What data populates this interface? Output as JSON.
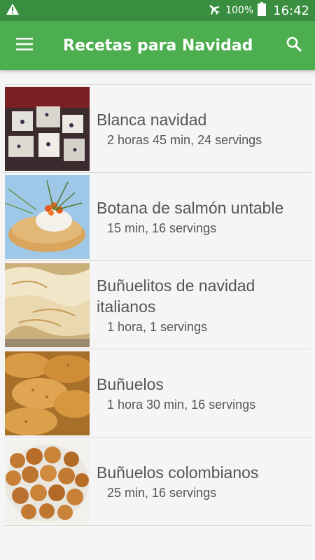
{
  "status_bar": {
    "battery_percent": "100%",
    "time": "16:42",
    "icons": [
      "warning-icon",
      "airplane-mode-icon",
      "battery-icon"
    ]
  },
  "app_bar": {
    "title": "Recetas para Navidad",
    "icons": [
      "menu-icon",
      "search-icon"
    ]
  },
  "recipes": [
    {
      "title": "Blanca navidad",
      "meta": "2 horas 45 min, 24 servings"
    },
    {
      "title": "Botana de salmón untable",
      "meta": "15 min, 16 servings"
    },
    {
      "title": "Buñuelitos de navidad italianos",
      "meta": "1 hora, 1 servings"
    },
    {
      "title": "Buñuelos",
      "meta": "1 hora 30 min, 16 servings"
    },
    {
      "title": "Buñuelos colombianos",
      "meta": "25 min, 16 servings"
    }
  ],
  "colors": {
    "status_bar": "#3a8e3f",
    "app_bar": "#4cae4f",
    "background": "#f5f5f5",
    "text": "#555555"
  }
}
